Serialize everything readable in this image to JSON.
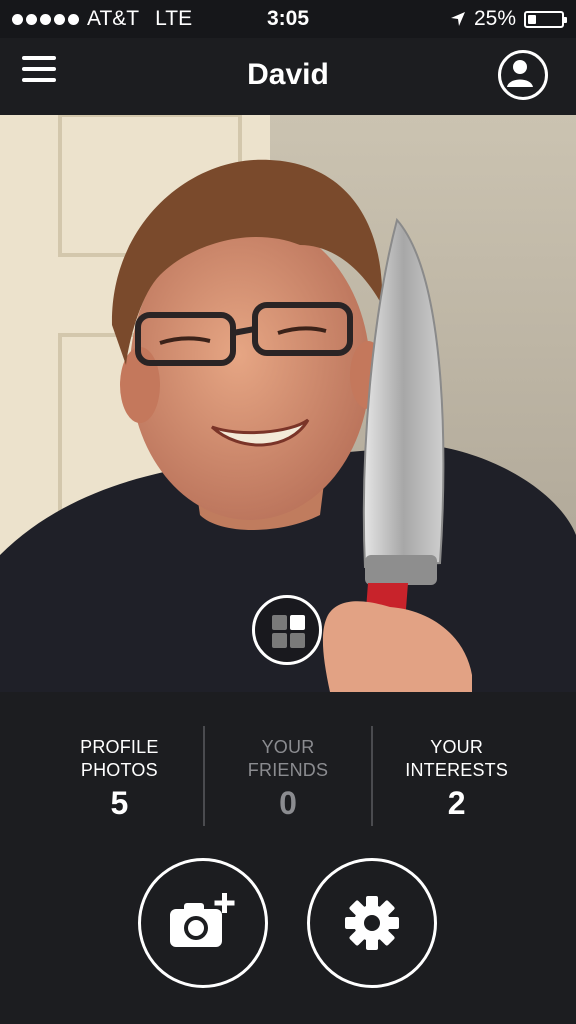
{
  "status_bar": {
    "carrier": "AT&T",
    "network": "LTE",
    "time": "3:05",
    "battery_text": "25%",
    "battery_level": 0.25,
    "signal_bars": 5
  },
  "nav": {
    "title": "David",
    "menu_icon": "hamburger-menu-icon",
    "profile_icon": "user-profile-icon"
  },
  "photo": {
    "gallery_icon": "grid-view-icon"
  },
  "stats": [
    {
      "label_line1": "PROFILE",
      "label_line2": "PHOTOS",
      "count": "5",
      "active": true
    },
    {
      "label_line1": "YOUR",
      "label_line2": "FRIENDS",
      "count": "0",
      "active": false
    },
    {
      "label_line1": "YOUR",
      "label_line2": "INTERESTS",
      "count": "2",
      "active": true
    }
  ],
  "actions": {
    "add_photo_icon": "camera-add-icon",
    "settings_icon": "gear-icon"
  },
  "colors": {
    "background": "#1c1d20",
    "text": "#ffffff",
    "dim_text": "#8b8c90",
    "knife_handle": "#c8232b"
  }
}
